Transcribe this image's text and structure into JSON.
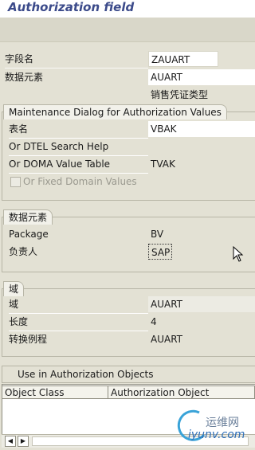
{
  "window": {
    "title": "Authorization field"
  },
  "header_fields": [
    {
      "label": "字段名",
      "value": "ZAUART"
    },
    {
      "label": "数据元素",
      "value": "AUART",
      "description": "销售凭证类型"
    }
  ],
  "maintenance_dialog": {
    "title": "Maintenance Dialog for Authorization Values",
    "rows": [
      {
        "label": "表名",
        "value": "VBAK"
      },
      {
        "label": "Or DTEL Search Help",
        "value": ""
      },
      {
        "label": "Or DOMA Value Table",
        "value": "TVAK"
      }
    ],
    "checkbox": {
      "label": "Or Fixed Domain Values",
      "checked": false,
      "disabled": true
    }
  },
  "data_element": {
    "title": "数据元素",
    "rows": [
      {
        "label": "Package",
        "value": "BV"
      },
      {
        "label": "负责人",
        "value": "SAP"
      }
    ]
  },
  "domain": {
    "title": "域",
    "rows": [
      {
        "label": "域",
        "value": "AUART"
      },
      {
        "label": "长度",
        "value": "4"
      },
      {
        "label": "转换例程",
        "value": "AUART"
      }
    ]
  },
  "auth_objects": {
    "title": "Use in Authorization Objects",
    "columns": [
      "Object Class",
      "Authorization Object"
    ]
  },
  "icons": {
    "cursor": "mouse-pointer-icon",
    "scroll_left": "left-arrow-icon",
    "scroll_right": "right-arrow-icon"
  },
  "watermark": {
    "text_cn": "运维网",
    "text_en": "iyunv.com"
  }
}
